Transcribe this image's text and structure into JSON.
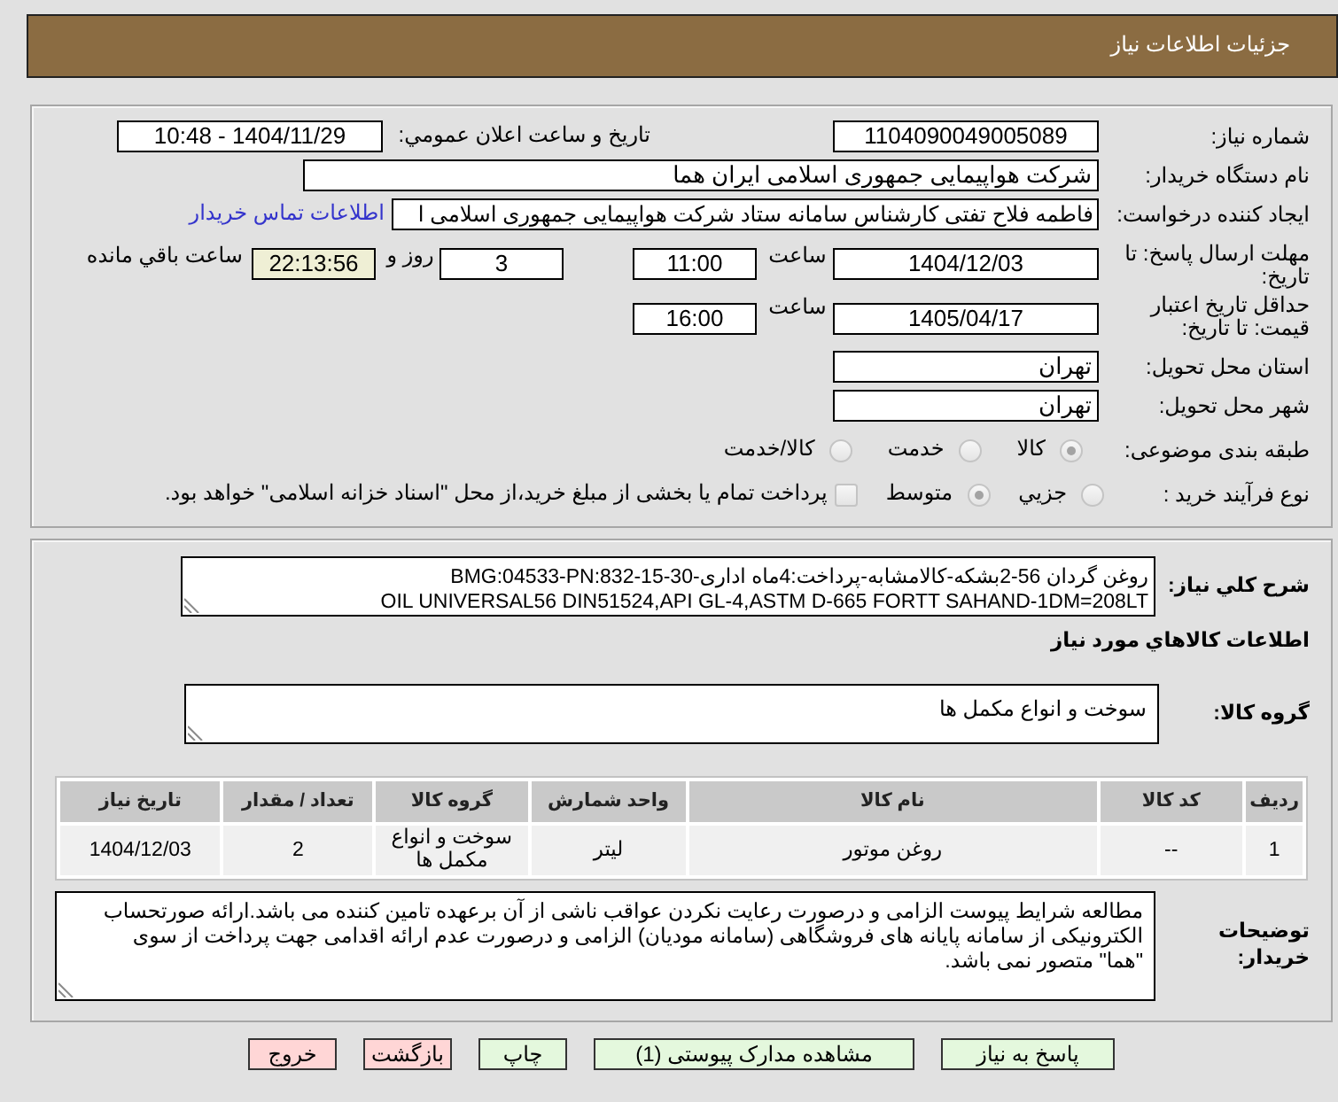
{
  "header": {
    "title": "جزئیات اطلاعات نیاز"
  },
  "need": {
    "number": {
      "label": "شماره نیاز:",
      "value": "1104090049005089"
    },
    "announced": {
      "label": "تاریخ و ساعت اعلان عمومي:",
      "value": "1404/11/29 - 10:48"
    },
    "buyer": {
      "label": "نام دستگاه خریدار:",
      "value": "شرکت هواپیمایی جمهوری اسلامی ایران هما"
    },
    "requester": {
      "label": "ایجاد کننده درخواست:",
      "value": "فاطمه فلاح تفتی کارشناس سامانه ستاد شرکت هواپیمایی جمهوری اسلامی ا",
      "contact_link": "اطلاعات تماس خریدار"
    },
    "reply_deadline": {
      "label": "مهلت ارسال پاسخ: تا تاریخ:",
      "date": "1404/12/03",
      "time_label": "ساعت",
      "time": "11:00",
      "days": "3",
      "days_label": "روز و",
      "remaining": "22:13:56",
      "remaining_label": "ساعت باقي مانده"
    },
    "price_validity": {
      "label": "حداقل تاریخ اعتبار قیمت: تا تاریخ:",
      "date": "1405/04/17",
      "time_label": "ساعت",
      "time": "16:00"
    },
    "province": {
      "label": "استان محل تحویل:",
      "value": "تهران"
    },
    "city": {
      "label": "شهر محل تحویل:",
      "value": "تهران"
    },
    "category": {
      "label": "طبقه بندی موضوعی:",
      "disabled": true,
      "options": [
        {
          "label": "کالا",
          "selected": true
        },
        {
          "label": "خدمت",
          "selected": false
        },
        {
          "label": "کالا/خدمت",
          "selected": false
        }
      ]
    },
    "process": {
      "label": "نوع فرآیند خرید :",
      "disabled": true,
      "options": [
        {
          "label": "جزيي",
          "selected": false
        },
        {
          "label": "متوسط",
          "selected": true
        }
      ],
      "treasury": {
        "label": "پرداخت تمام یا بخشی از مبلغ خرید،از محل \"اسناد خزانه اسلامی\" خواهد بود.",
        "checked": false,
        "disabled": true
      }
    }
  },
  "goods": {
    "description": {
      "label": "شرح کلي نياز:",
      "text": "روغن گردان 56-2بشکه-کالامشابه-پرداخت:4ماه اداری-BMG:04533-PN:832-15-30\nOIL UNIVERSAL56 DIN51524,API GL-4,ASTM D-665 FORTT SAHAND-1DM=208LT"
    },
    "section_title": "اطلاعات کالاهاي مورد نياز",
    "group": {
      "label": "گروه کالا:",
      "value": "سوخت و انواع مکمل ها"
    },
    "table": {
      "columns": [
        "ردیف",
        "کد کالا",
        "نام کالا",
        "واحد شمارش",
        "گروه کالا",
        "تعداد / مقدار",
        "تاریخ نیاز"
      ],
      "rows": [
        [
          "1",
          "--",
          "روغن موتور",
          "لیتر",
          "سوخت و انواع مکمل ها",
          "2",
          "1404/12/03"
        ]
      ]
    },
    "notes": {
      "label": "توضیحات خریدار:",
      "text": "مطالعه شرایط پیوست الزامی و درصورت رعایت نکردن عواقب ناشی از آن برعهده تامین کننده می باشد.ارائه صورتحساب الکترونیکی از سامانه پایانه های فروشگاهی (سامانه مودیان) الزامی و درصورت عدم ارائه اقدامی جهت پرداخت از سوی \"هما\" متصور نمی باشد."
    }
  },
  "buttons": [
    {
      "label": "پاسخ به نیاز",
      "kind": "confirm"
    },
    {
      "label": "مشاهده مدارک پیوستی (1)",
      "kind": "confirm"
    },
    {
      "label": "چاپ",
      "kind": "confirm"
    },
    {
      "label": "بازگشت",
      "kind": "exit"
    },
    {
      "label": "خروج",
      "kind": "exit"
    }
  ]
}
